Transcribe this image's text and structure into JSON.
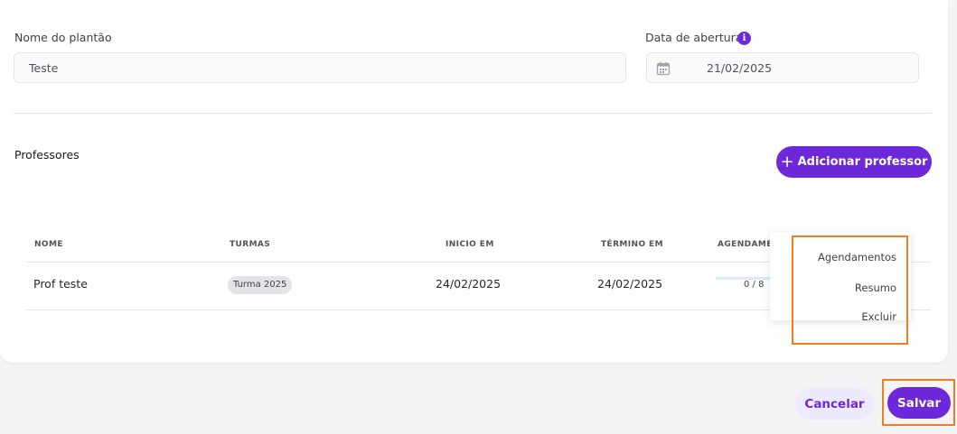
{
  "form": {
    "name_label": "Nome do plantão",
    "name_value": "Teste",
    "date_label": "Data de abertura",
    "date_value": "21/02/2025"
  },
  "professors": {
    "title": "Professores",
    "add_button_icon": "+",
    "add_button_label": "Adicionar professor",
    "table": {
      "headers": [
        "NOME",
        "TURMAS",
        "INICIO EM",
        "TÉRMINO EM",
        "AGENDAMEN"
      ],
      "rows": [
        {
          "name": "Prof teste",
          "class": "Turma 2025",
          "start": "24/02/2025",
          "end": "24/02/2025",
          "schedule_progress": "0 / 8",
          "schedule_fraction": 0
        }
      ]
    }
  },
  "context_menu": {
    "items": [
      "Agendamentos",
      "Resumo",
      "Excluir"
    ]
  },
  "footer": {
    "cancel_label": "Cancelar",
    "save_label": "Salvar"
  },
  "colors": {
    "accent": "#6d28d9",
    "accent_light": "#ede9fe",
    "highlight": "#f47b20"
  },
  "icons": {
    "date_info": "info-icon",
    "date_field": "calendar-icon"
  }
}
